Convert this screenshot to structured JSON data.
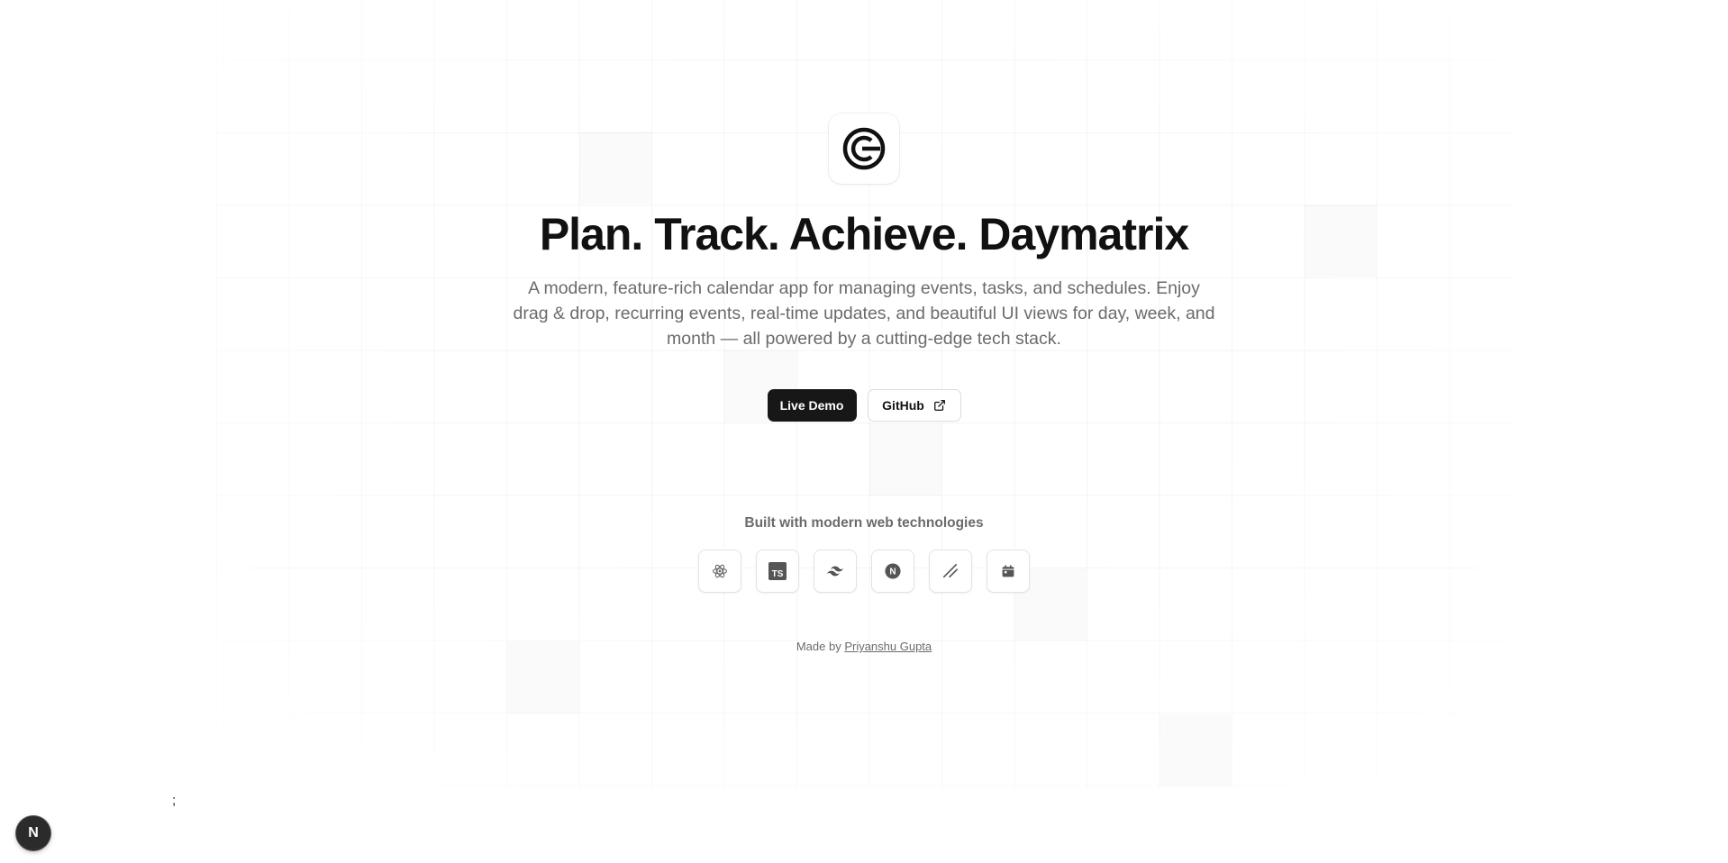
{
  "hero": {
    "headline": "Plan. Track. Achieve. Daymatrix",
    "subtitle": "A modern, feature-rich calendar app for managing events, tasks, and schedules. Enjoy drag & drop, recurring events, real-time updates, and beautiful UI views for day, week, and month — all powered by a cutting-edge tech stack."
  },
  "actions": {
    "primary_label": "Live Demo",
    "secondary_label": "GitHub"
  },
  "tech": {
    "label": "Built with modern web technologies",
    "icons": [
      "react-icon",
      "typescript-icon",
      "tailwind-icon",
      "nextjs-icon",
      "shadcn-icon",
      "calendar-icon"
    ],
    "ts_text": "TS",
    "next_letter": "N"
  },
  "footer": {
    "prefix": "Made by ",
    "author": "Priyanshu Gupta"
  },
  "stray_text": ";",
  "dev_badge": {
    "letter": "N"
  },
  "colors": {
    "primary": "#171717",
    "muted_text": "#6b6b6b",
    "background": "#ffffff"
  }
}
